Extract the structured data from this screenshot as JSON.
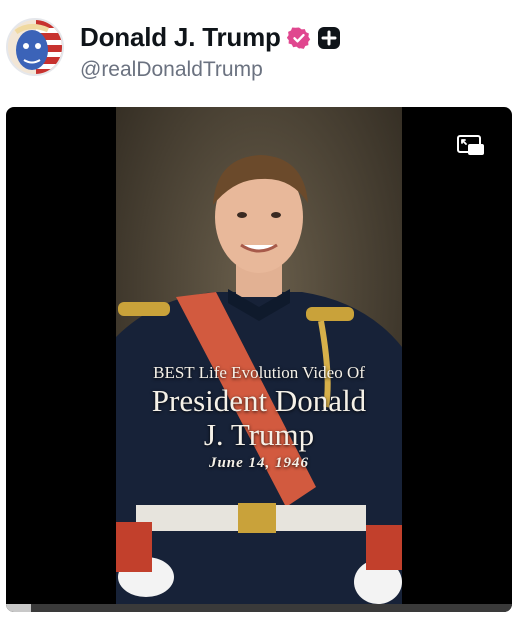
{
  "post": {
    "display_name": "Donald J. Trump",
    "handle": "@realDonaldTrump",
    "badges": [
      "verified-icon",
      "plus-icon"
    ],
    "avatar_icon": "avatar-american-flag-portrait"
  },
  "video": {
    "caption_line1": "BEST Life Evolution Video Of",
    "caption_line2": "President Donald",
    "caption_line3": "J. Trump",
    "caption_date": "June 14, 1946",
    "pip_icon": "picture-in-picture-icon",
    "progress": 0.05
  },
  "colors": {
    "verified_badge": "#e0478f",
    "text_primary": "#0f1419",
    "text_secondary": "#6b7280",
    "video_bg": "#000000"
  }
}
